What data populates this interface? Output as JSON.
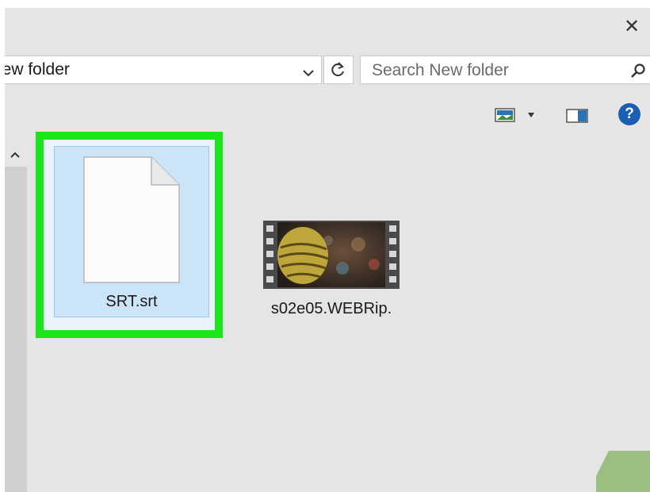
{
  "titlebar": {
    "close_glyph": "✕"
  },
  "address": {
    "path_text": "lew folder"
  },
  "search": {
    "placeholder": "Search New folder"
  },
  "toolbar": {
    "icons": [
      "view-options-icon",
      "chevron-down-icon",
      "preview-pane-icon",
      "help-icon"
    ],
    "help_glyph": "?"
  },
  "files": [
    {
      "name": "SRT.srt",
      "type": "document",
      "selected": true,
      "highlighted": true
    },
    {
      "name": "s02e05.WEBRip.",
      "type": "video"
    }
  ],
  "colors": {
    "highlight": "#19e619",
    "selection_fill": "#cce4f7",
    "selection_border": "#99c9ef",
    "help_blue": "#1a5fb4"
  }
}
